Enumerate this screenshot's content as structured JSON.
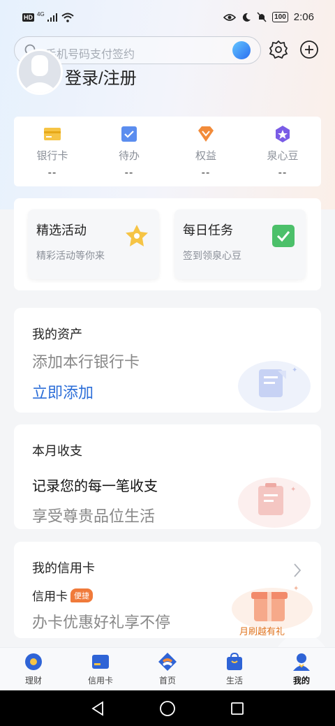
{
  "status_bar": {
    "hd_label": "HD",
    "network_label": "4G",
    "battery": "100",
    "time": "2:06"
  },
  "search": {
    "placeholder": "手机号码支付签约"
  },
  "user": {
    "login_label": "登录/注册"
  },
  "stats": [
    {
      "label": "银行卡",
      "value": "--",
      "icon": "bank-card-icon"
    },
    {
      "label": "待办",
      "value": "--",
      "icon": "todo-check-icon"
    },
    {
      "label": "权益",
      "value": "--",
      "icon": "rights-gem-icon"
    },
    {
      "label": "泉心豆",
      "value": "--",
      "icon": "bean-star-icon"
    }
  ],
  "activities": [
    {
      "title": "精选活动",
      "subtitle": "精彩活动等你来",
      "icon": "star-icon"
    },
    {
      "title": "每日任务",
      "subtitle": "签到领泉心豆",
      "icon": "task-check-icon"
    }
  ],
  "assets": {
    "title": "我的资产",
    "subtitle": "添加本行银行卡",
    "action": "立即添加"
  },
  "monthly": {
    "title": "本月收支",
    "headline": "记录您的每一笔收支",
    "subtitle": "享受尊贵品位生活"
  },
  "credit": {
    "title": "我的信用卡",
    "tag_label": "信用卡",
    "badge": "便捷",
    "subtitle": "办卡优惠好礼享不停",
    "promo": "月刷越有礼"
  },
  "bottom_nav": [
    {
      "label": "理财",
      "icon": "wealth-icon"
    },
    {
      "label": "信用卡",
      "icon": "credit-card-icon"
    },
    {
      "label": "首页",
      "icon": "home-logo-icon"
    },
    {
      "label": "生活",
      "icon": "life-bag-icon"
    },
    {
      "label": "我的",
      "icon": "profile-icon",
      "active": true
    }
  ],
  "colors": {
    "accent_blue": "#2c6ed8",
    "badge_orange": "#f07a3a",
    "promo_orange": "#e0741f"
  }
}
